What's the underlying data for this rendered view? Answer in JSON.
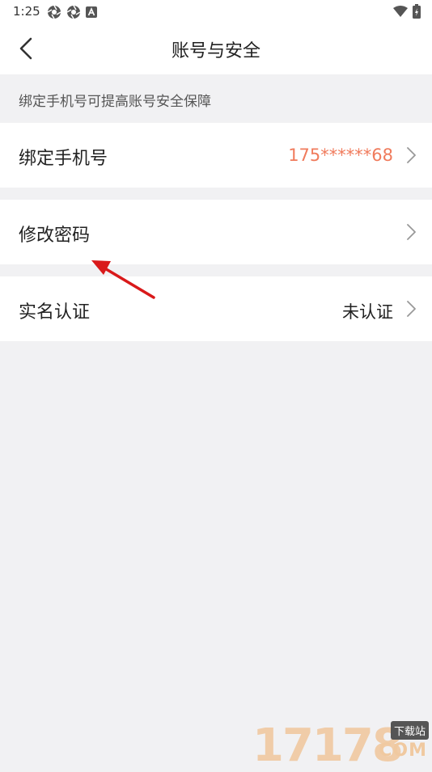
{
  "status_bar": {
    "time": "1:25",
    "left_icons": [
      "shutter-icon",
      "shutter-icon",
      "app-a-icon"
    ],
    "right_icons": [
      "wifi-icon",
      "battery-icon"
    ]
  },
  "nav": {
    "title": "账号与安全",
    "back_icon": "chevron-left-icon"
  },
  "hint": {
    "text": "绑定手机号可提高账号安全保障"
  },
  "rows": [
    {
      "label": "绑定手机号",
      "value": "175******68",
      "value_color": "#f07b5c"
    },
    {
      "label": "修改密码",
      "value": "",
      "value_color": "#222222"
    },
    {
      "label": "实名认证",
      "value": "未认证",
      "value_color": "#222222"
    }
  ],
  "annotation": {
    "arrow_color": "#d9191a"
  },
  "watermark": {
    "digits": "17178",
    "badge": "下载站",
    "suffix": "COM"
  }
}
